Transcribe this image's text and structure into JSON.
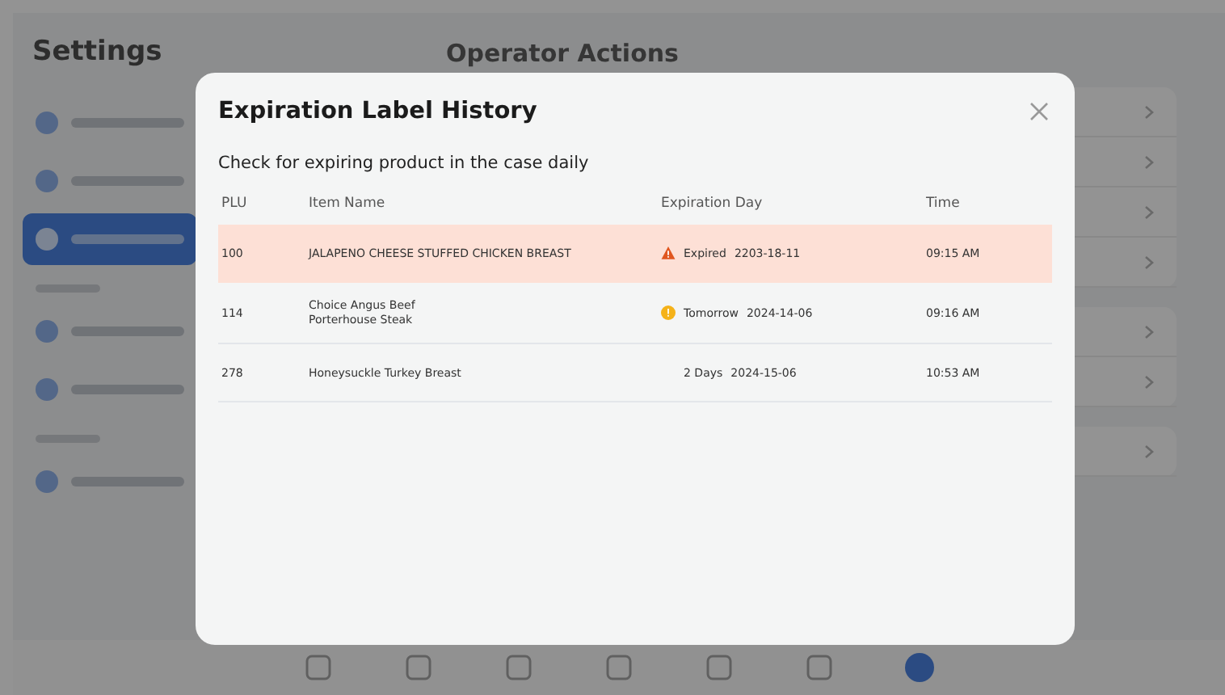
{
  "background": {
    "sidebar_title": "Settings",
    "page_title": "Operator Actions",
    "sidebar": [
      {
        "kind": "item",
        "selected": false
      },
      {
        "kind": "item",
        "selected": false
      },
      {
        "kind": "item",
        "selected": true
      },
      {
        "kind": "section"
      },
      {
        "kind": "item",
        "selected": false
      },
      {
        "kind": "item",
        "selected": false
      },
      {
        "kind": "section"
      },
      {
        "kind": "item",
        "selected": false
      }
    ],
    "nav": [
      {
        "selected": false
      },
      {
        "selected": false
      },
      {
        "selected": false
      },
      {
        "selected": false
      },
      {
        "selected": false
      },
      {
        "selected": false
      },
      {
        "selected": true
      }
    ]
  },
  "dialog": {
    "title": "Expiration Label History",
    "subtitle": "Check for expiring product in the case daily",
    "columns": [
      "PLU",
      "Item Name",
      "Expiration Day",
      "Time"
    ],
    "rows": [
      {
        "plu": "100",
        "item_name": [
          "JALAPENO CHEESE STUFFED CHICKEN BREAST"
        ],
        "kind": "expired",
        "expiry_label": "Expired",
        "expiry_date": "2203-18-11",
        "time": "09:15 AM"
      },
      {
        "plu": "114",
        "item_name": [
          "Choice Angus Beef",
          "Porterhouse Steak"
        ],
        "kind": "warning",
        "expiry_label": "Tomorrow",
        "expiry_date": "2024-14-06",
        "time": "09:16 AM"
      },
      {
        "plu": "278",
        "item_name": [
          "Honeysuckle Turkey Breast"
        ],
        "kind": "ok",
        "expiry_label": "2 Days",
        "expiry_date": "2024-15-06",
        "time": "10:53 AM"
      }
    ]
  }
}
